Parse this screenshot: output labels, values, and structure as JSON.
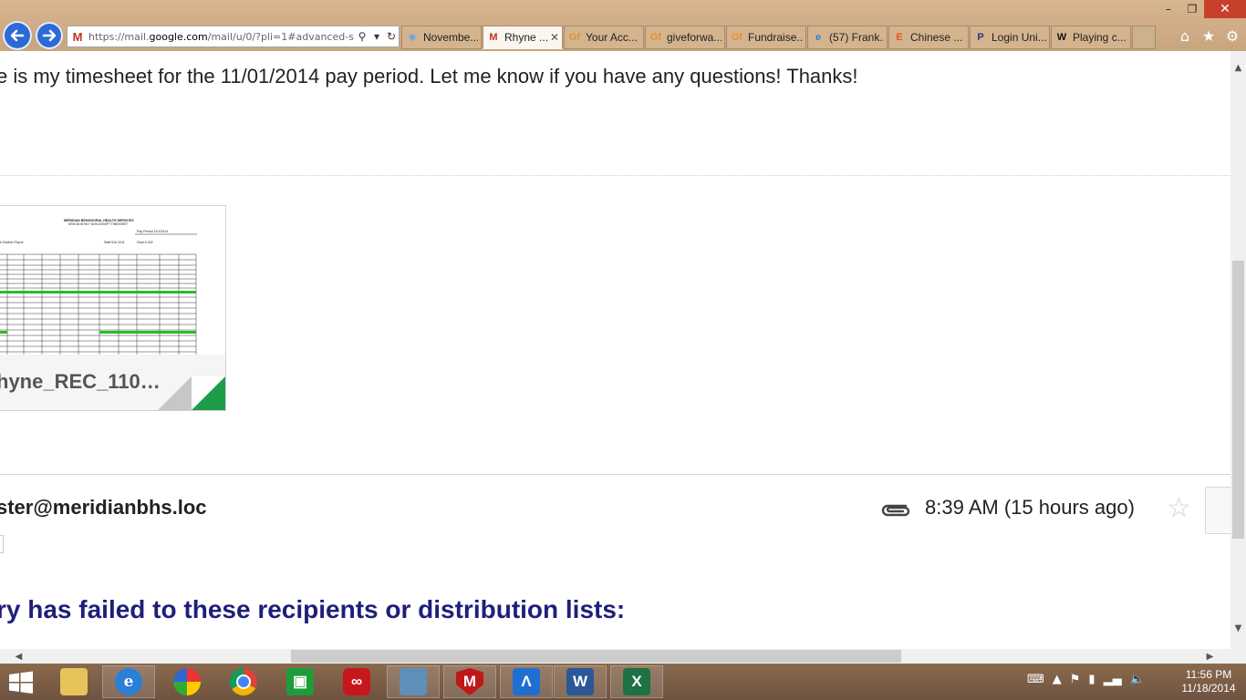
{
  "browser": {
    "address_url_prefix": "https://mail.",
    "address_url_domain": "google.com",
    "address_url_rest": "/mail/u/0/?pli=1#advanced-s",
    "tabs": [
      {
        "label": "Novembe...",
        "icon": "weather-icon",
        "active": false
      },
      {
        "label": "Rhyne ...",
        "icon": "gmail-icon",
        "active": true
      },
      {
        "label": "Your Acc...",
        "icon": "gf-icon",
        "active": false
      },
      {
        "label": "giveforwa...",
        "icon": "gf-icon",
        "active": false
      },
      {
        "label": "Fundraise...",
        "icon": "gf-icon",
        "active": false
      },
      {
        "label": "(57) Frank...",
        "icon": "ie-icon",
        "active": false
      },
      {
        "label": "Chinese ...",
        "icon": "etsy-icon",
        "active": false
      },
      {
        "label": "Login Uni...",
        "icon": "paypal-icon",
        "active": false
      },
      {
        "label": "Playing c...",
        "icon": "wikipedia-icon",
        "active": false
      }
    ]
  },
  "email": {
    "body_text": "e is my timesheet for the 11/01/2014 pay period. Let me know if you have any questions! Thanks!",
    "attachment_name": "hyne_REC_110…",
    "sender": "ster@meridianbhs.loc",
    "time": "8:39 AM (15 hours ago)",
    "failure_text": "ry has failed to these recipients or distribution lists:"
  },
  "timesheet_thumb": {
    "title1": "MERIDIAN BEHAVIORAL HEALTH SERVICES",
    "title2": "SEMI MONTHLY NON-EXEMPT TIMESHEET",
    "pay_period": "Pay Period   11/1/2014",
    "name": "h Rachel Rhyne",
    "staff": "Staff ID#   1101",
    "dept": "Dept #   432"
  },
  "taskbar": {
    "time": "11:56 PM",
    "date": "11/18/2014"
  },
  "colors": {
    "chrome": "#c9a57e",
    "tab_active": "#fbf6f0",
    "nav_blue": "#2d6ad6",
    "failure_text": "#1f1f7a",
    "excel_green": "#1d9d4a",
    "taskbar": "#6e5340"
  }
}
